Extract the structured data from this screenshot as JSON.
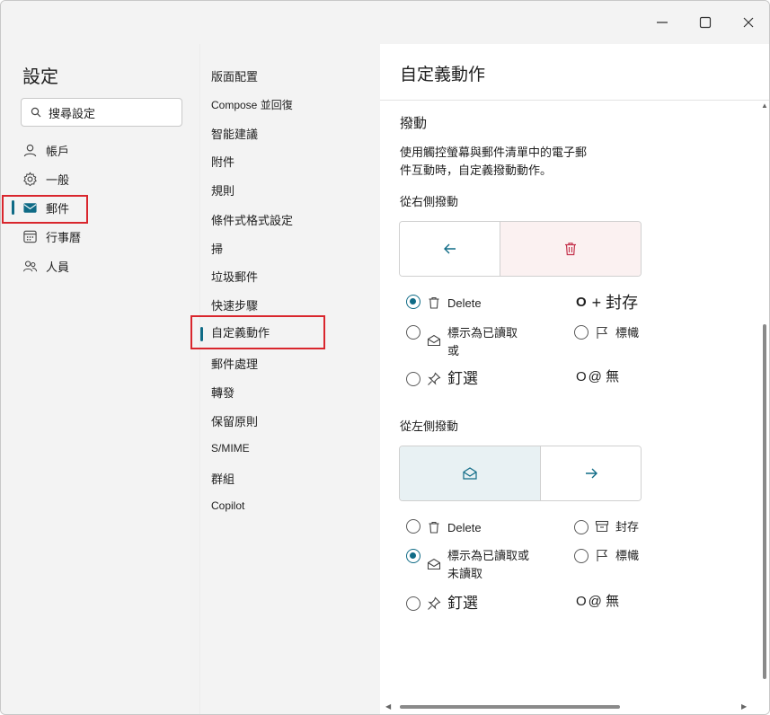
{
  "window": {
    "minimize_icon": "minimize-icon",
    "maximize_icon": "maximize-icon",
    "close_icon": "close-icon"
  },
  "settings": {
    "title": "設定",
    "search_placeholder": "搜尋設定",
    "nav": [
      {
        "label": "帳戶",
        "icon": "person-icon"
      },
      {
        "label": "一般",
        "icon": "gear-icon"
      },
      {
        "label": "郵件",
        "icon": "mail-icon",
        "selected": true
      },
      {
        "label": "行事曆",
        "icon": "calendar-icon"
      },
      {
        "label": "人員",
        "icon": "people-icon"
      }
    ]
  },
  "mail_menu": {
    "items": [
      "版面配置",
      "Compose 並回復",
      "智能建議",
      "附件",
      "規則",
      "條件式格式設定",
      "掃",
      "垃圾郵件",
      "快速步驟",
      "自定義動作",
      "郵件處理",
      "轉發",
      "保留原則",
      "S/MIME",
      "群組",
      "Copilot"
    ],
    "selected_index": 9
  },
  "pane": {
    "title": "自定義動作",
    "section": "撥動",
    "description": "使用觸控螢幕與郵件清單中的電子郵件互動時，自定義撥動動作。",
    "right_swipe": {
      "label": "從右側撥動",
      "options": [
        {
          "label": "Delete",
          "icon": "trash-icon",
          "checked": true
        },
        {
          "label": "+ 封存",
          "icon": "",
          "checked": false
        },
        {
          "label": "標示為已讀取或",
          "icon": "envelope-open-icon",
          "checked": false
        },
        {
          "label": "標幟",
          "icon": "flag-icon",
          "checked": false
        },
        {
          "label": "釘選",
          "icon": "pin-icon",
          "checked": false
        },
        {
          "label": "@ 無",
          "icon": "",
          "checked": false
        }
      ]
    },
    "left_swipe": {
      "label": "從左側撥動",
      "options": [
        {
          "label": "Delete",
          "icon": "trash-icon",
          "checked": false
        },
        {
          "label": "封存",
          "icon": "archive-icon",
          "checked": false
        },
        {
          "label": "標示為已讀取或未讀取",
          "icon": "envelope-open-icon",
          "checked": true
        },
        {
          "label": "標幟",
          "icon": "flag-icon",
          "checked": false
        },
        {
          "label": "釘選",
          "icon": "pin-icon",
          "checked": false
        },
        {
          "label": "@ 無",
          "icon": "",
          "checked": false
        }
      ]
    }
  },
  "colors": {
    "accent": "#0f6b86",
    "delete_red": "#c4314b",
    "highlight_box": "#d9262d"
  }
}
